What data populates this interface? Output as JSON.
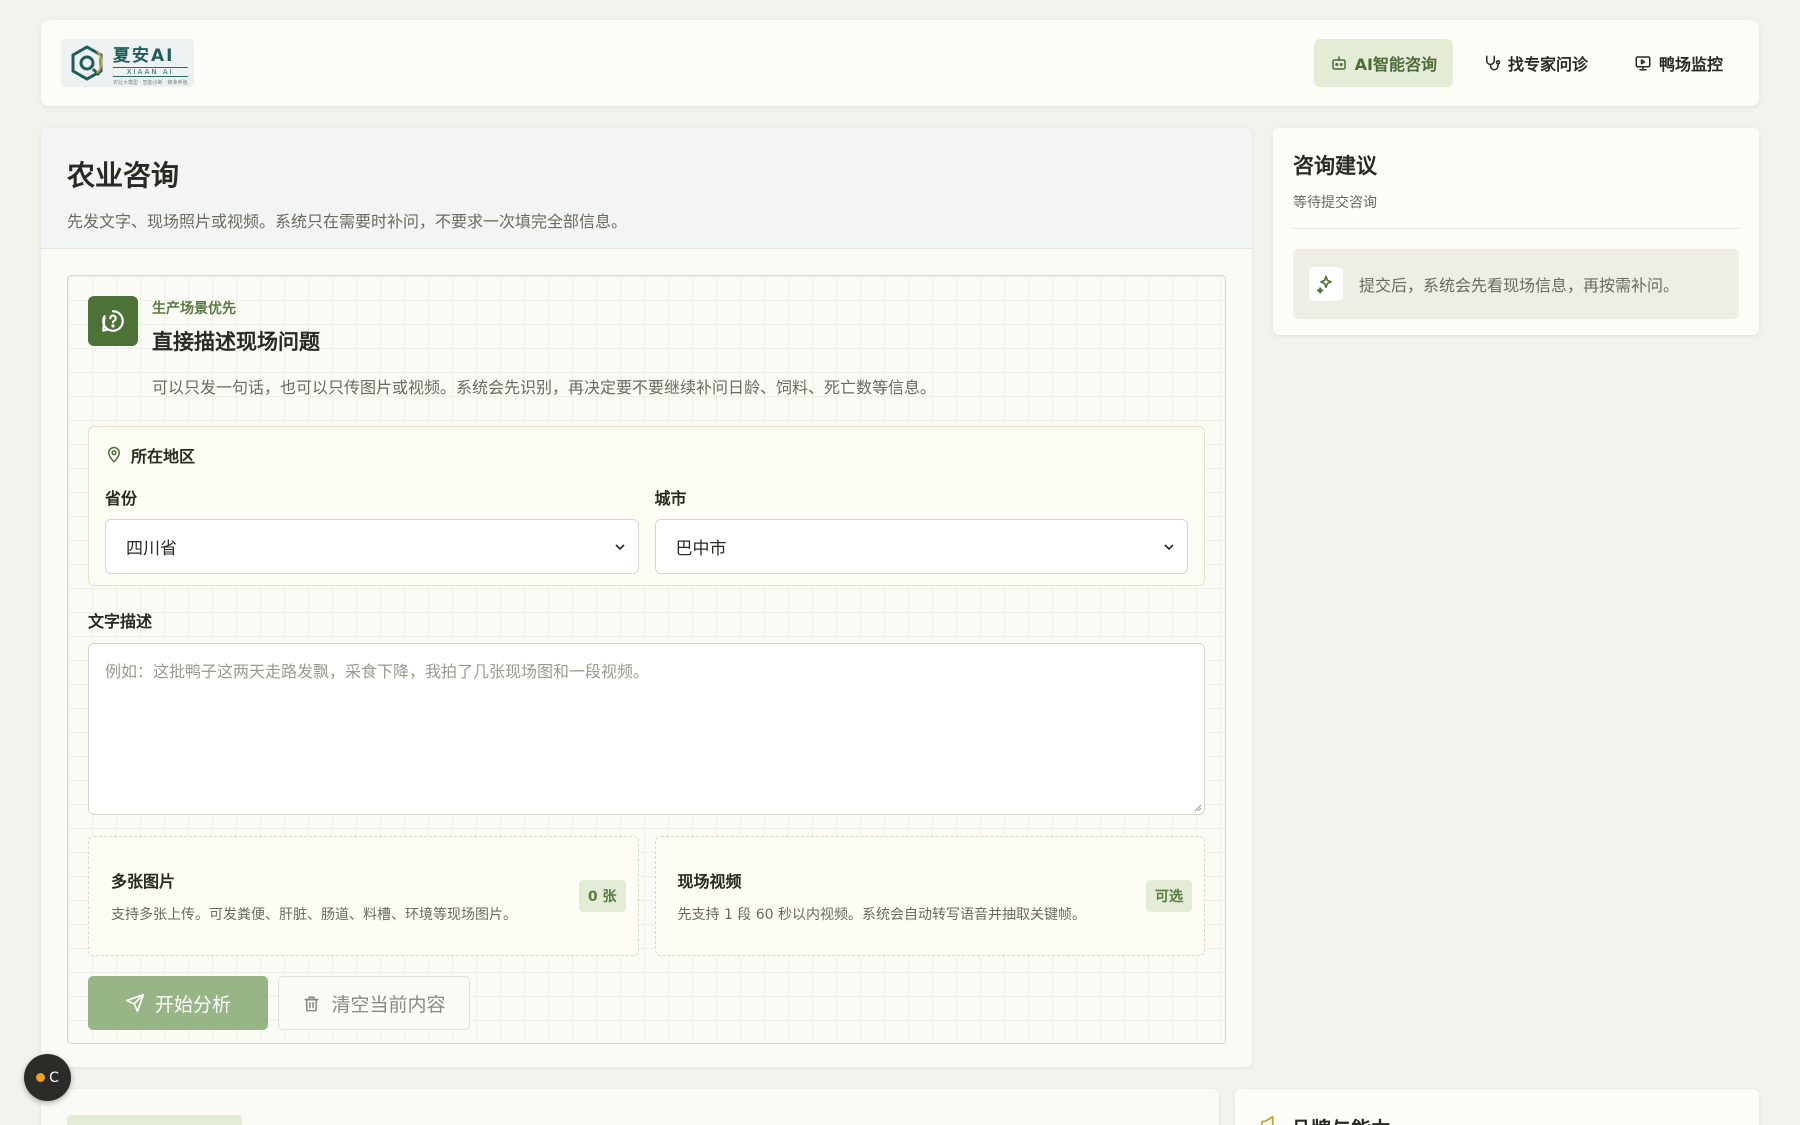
{
  "brand": {
    "title": "夏安AI",
    "subtitle": "XIAAN AI",
    "tagline": "农业大模型 · 智能诊断 · 精准养殖"
  },
  "nav": [
    {
      "label": "AI智能咨询",
      "icon": "robot-icon",
      "active": true
    },
    {
      "label": "找专家问诊",
      "icon": "stethoscope-icon",
      "active": false
    },
    {
      "label": "鸭场监控",
      "icon": "monitor-icon",
      "active": false
    }
  ],
  "page": {
    "title": "农业咨询",
    "description": "先发文字、现场照片或视频。系统只在需要时补问，不要求一次填完全部信息。"
  },
  "intro": {
    "tag": "生产场景优先",
    "title": "直接描述现场问题",
    "description": "可以只发一句话，也可以只传图片或视频。系统会先识别，再决定要不要继续补问日龄、饲料、死亡数等信息。"
  },
  "region": {
    "title": "所在地区",
    "province_label": "省份",
    "province_value": "四川省",
    "city_label": "城市",
    "city_value": "巴中市"
  },
  "text_input": {
    "label": "文字描述",
    "placeholder": "例如：这批鸭子这两天走路发飘，采食下降，我拍了几张现场图和一段视频。"
  },
  "uploads": {
    "images": {
      "title": "多张图片",
      "description": "支持多张上传。可发粪便、肝脏、肠道、料槽、环境等现场图片。",
      "badge": "0 张"
    },
    "video": {
      "title": "现场视频",
      "description": "先支持 1 段 60 秒以内视频。系统会自动转写语音并抽取关键帧。",
      "badge": "可选"
    }
  },
  "actions": {
    "submit": "开始分析",
    "clear": "清空当前内容"
  },
  "side": {
    "title": "咨询建议",
    "status": "等待提交咨询",
    "note": "提交后，系统会先看现场信息，再按需补问。"
  },
  "bottom": {
    "right_title": "品牌与能力"
  },
  "floating": {
    "label": "C"
  },
  "colors": {
    "accent": "#4d7238",
    "accent_light": "#e3ecd4",
    "primary_button": "#97b586",
    "background": "#f3f2ec"
  }
}
